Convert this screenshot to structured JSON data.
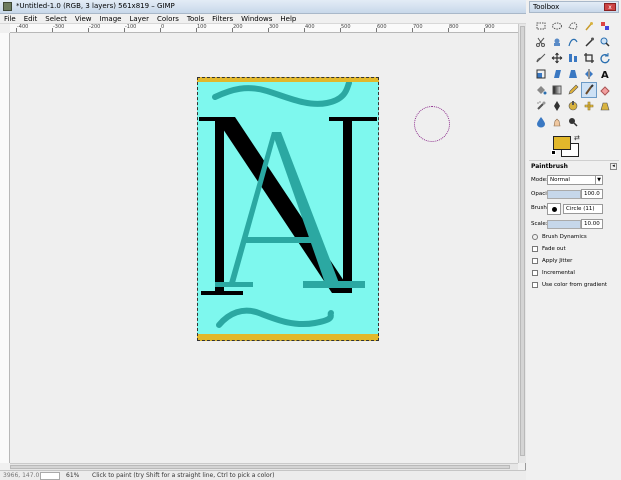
{
  "window": {
    "title": "*Untitled-1.0 (RGB, 3 layers) 561x819 – GIMP"
  },
  "menubar": [
    "File",
    "Edit",
    "Select",
    "View",
    "Image",
    "Layer",
    "Colors",
    "Tools",
    "Filters",
    "Windows",
    "Help"
  ],
  "ruler": {
    "h_labels": [
      "-400",
      "-300",
      "-200",
      "-100",
      "0",
      "100",
      "200",
      "300",
      "400",
      "500",
      "600",
      "700",
      "800",
      "900"
    ]
  },
  "statusbar": {
    "coords": "3966, 147.0",
    "zoom": "61%",
    "hint": "Click to paint (try Shift for a straight line, Ctrl to pick a color)"
  },
  "toolbox": {
    "title": "Toolbox",
    "close_label": "x",
    "tools": [
      "rect-select",
      "ellipse-select",
      "free-select",
      "fuzzy-select",
      "select-by-color",
      "scissors-select",
      "foreground-select",
      "paths",
      "color-picker",
      "zoom",
      "measure",
      "move",
      "align",
      "crop",
      "rotate",
      "scale",
      "shear",
      "perspective",
      "flip",
      "text",
      "bucket-fill",
      "blend",
      "pencil",
      "paintbrush",
      "eraser",
      "airbrush",
      "ink",
      "clone",
      "heal",
      "perspective-clone",
      "blur",
      "smudge",
      "dodge-burn"
    ],
    "active_tool": "paintbrush",
    "colors": {
      "foreground": "#e2b82b",
      "background": "#ffffff"
    }
  },
  "tool_options": {
    "header": "Paintbrush",
    "mode_label": "Mode:",
    "mode_value": "Normal",
    "opacity_label": "Opacity:",
    "opacity_value": "100.0",
    "opacity_fraction": 1.0,
    "brush_label": "Brush:",
    "brush_value": "Circle (11)",
    "scale_label": "Scale:",
    "scale_value": "10.00",
    "brush_dynamics_label": "Brush Dynamics",
    "fade_out_label": "Fade out",
    "apply_jitter_label": "Apply Jitter",
    "incremental_label": "Incremental",
    "color_from_gradient_label": "Use color from gradient"
  },
  "image": {
    "background_color": "#7ef8ee",
    "band_color": "#e2b82b",
    "letter_n_color": "#000000",
    "letter_a_color": "#2ba8a2",
    "stroke_color": "#2ba8a2"
  }
}
